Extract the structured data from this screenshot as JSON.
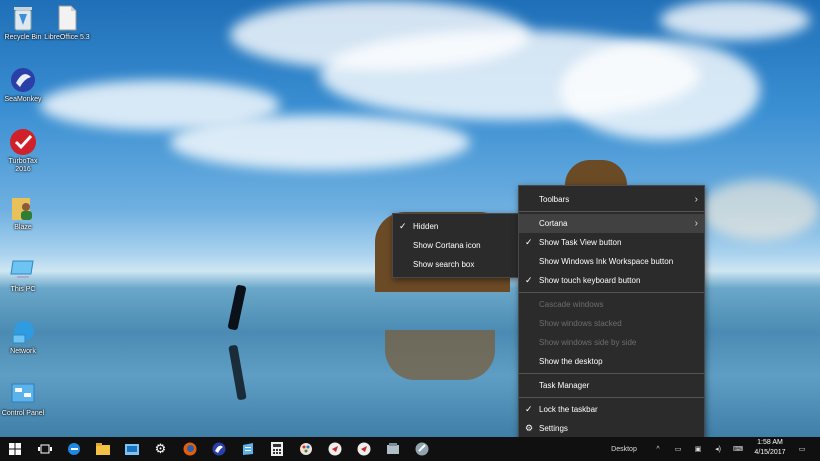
{
  "desktop_icons": [
    {
      "label": "Recycle Bin",
      "icon": "recycle-bin-icon"
    },
    {
      "label": "LibreOffice 5.3",
      "icon": "libreoffice-icon"
    },
    {
      "label": "SeaMonkey",
      "icon": "seamonkey-icon"
    },
    {
      "label": "TurboTax 2016",
      "icon": "turbotax-icon"
    },
    {
      "label": "Blaze",
      "icon": "user-folder-icon"
    },
    {
      "label": "This PC",
      "icon": "this-pc-icon"
    },
    {
      "label": "Network",
      "icon": "network-icon"
    },
    {
      "label": "Control Panel",
      "icon": "control-panel-icon"
    }
  ],
  "cortana_submenu": {
    "items": [
      {
        "label": "Hidden",
        "checked": true
      },
      {
        "label": "Show Cortana icon",
        "checked": false
      },
      {
        "label": "Show search box",
        "checked": false
      }
    ]
  },
  "taskbar_menu": {
    "toolbars": "Toolbars",
    "cortana": "Cortana",
    "show_task_view": "Show Task View button",
    "show_ink_workspace": "Show Windows Ink Workspace button",
    "show_touch_keyboard": "Show touch keyboard button",
    "cascade": "Cascade windows",
    "stacked": "Show windows stacked",
    "side_by_side": "Show windows side by side",
    "show_desktop": "Show the desktop",
    "task_manager": "Task Manager",
    "lock_taskbar": "Lock the taskbar",
    "settings": "Settings"
  },
  "taskbar": {
    "desktop_label": "Desktop",
    "time": "1:58 AM",
    "date": "4/15/2017",
    "pinned": [
      "start-icon",
      "task-view-icon",
      "edge-icon",
      "file-explorer-icon",
      "store-icon",
      "settings-gear-icon",
      "firefox-icon",
      "seamonkey-icon",
      "wordpad-icon",
      "calculator-icon",
      "paint-icon",
      "app-icon-1",
      "app-icon-2",
      "app-icon-3",
      "app-icon-4"
    ]
  }
}
